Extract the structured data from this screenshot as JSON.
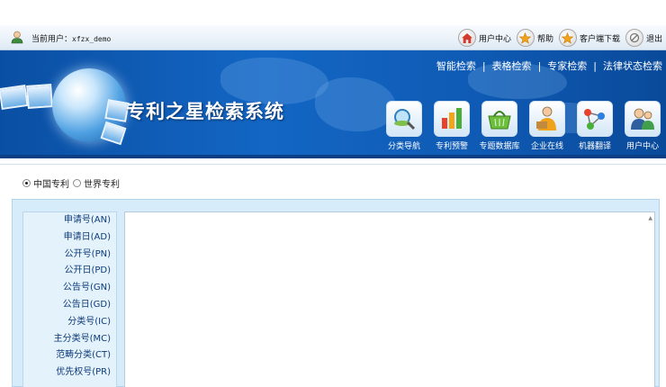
{
  "userbar": {
    "label": "当前用户：",
    "username": "xfzx_demo",
    "links": [
      {
        "label": "用户中心",
        "icon": "home-icon"
      },
      {
        "label": "帮助",
        "icon": "star-icon"
      },
      {
        "label": "客户端下载",
        "icon": "star-icon"
      },
      {
        "label": "退出",
        "icon": "logout-icon"
      }
    ]
  },
  "banner": {
    "title": "专利之星检索系统",
    "search_links": [
      "智能检索",
      "表格检索",
      "专家检索",
      "法律状态检索"
    ],
    "nav_items": [
      {
        "label": "分类导航",
        "icon": "magnifier-icon"
      },
      {
        "label": "专利预警",
        "icon": "bar-chart-icon"
      },
      {
        "label": "专题数据库",
        "icon": "basket-icon"
      },
      {
        "label": "企业在线",
        "icon": "business-icon"
      },
      {
        "label": "机器翻译",
        "icon": "network-icon"
      },
      {
        "label": "用户中心",
        "icon": "users-icon"
      }
    ]
  },
  "scope": {
    "options": [
      "中国专利",
      "世界专利"
    ],
    "selected": "中国专利"
  },
  "fields": [
    "申请号(AN)",
    "申请日(AD)",
    "公开号(PN)",
    "公开日(PD)",
    "公告号(GN)",
    "公告日(GD)",
    "分类号(IC)",
    "主分类号(MC)",
    "范畴分类(CT)",
    "优先权号(PR)"
  ],
  "colors": {
    "banner": "#1366c4",
    "panel": "#d6ecfa",
    "field_text": "#0d3b7a"
  }
}
